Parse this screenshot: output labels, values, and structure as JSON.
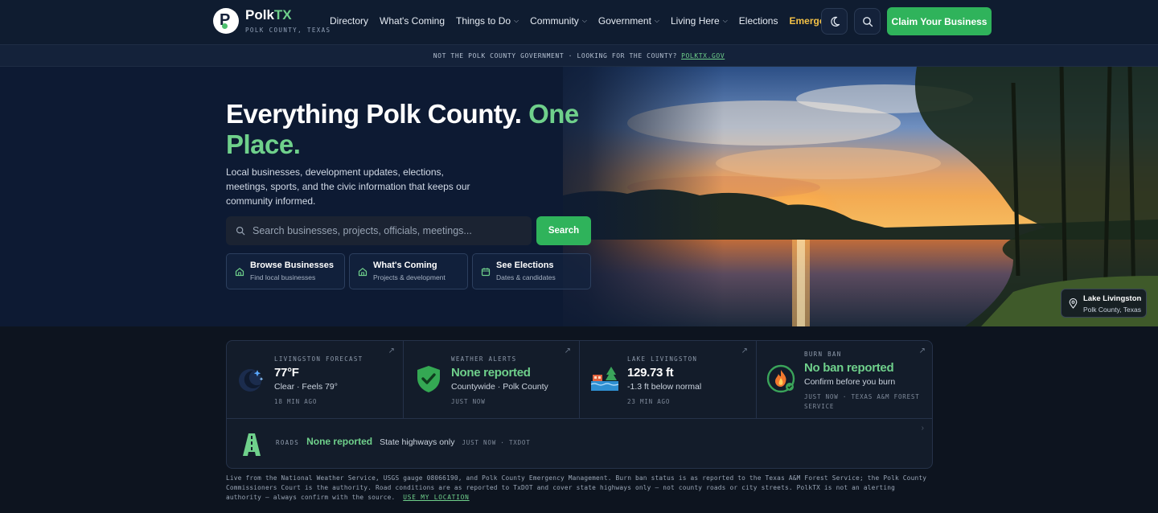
{
  "nav": {
    "brand": "Polk",
    "brand_accent": "TX",
    "brand_sub": "POLK COUNTY, TEXAS",
    "items": [
      {
        "label": "Directory",
        "dropdown": false
      },
      {
        "label": "What's Coming",
        "dropdown": false
      },
      {
        "label": "Things to Do",
        "dropdown": true
      },
      {
        "label": "Community",
        "dropdown": true
      },
      {
        "label": "Government",
        "dropdown": true
      },
      {
        "label": "Living Here",
        "dropdown": true
      },
      {
        "label": "Elections",
        "dropdown": false
      },
      {
        "label": "Emergency",
        "dropdown": false
      }
    ],
    "claim_label": "Claim Your Business"
  },
  "notice": {
    "text": "NOT THE POLK COUNTY GOVERNMENT · LOOKING FOR THE COUNTY?",
    "link": "POLKTX.GOV"
  },
  "hero": {
    "title_a": "Everything Polk County.",
    "title_b": "One Place.",
    "lead": "Local businesses, development updates, elections, meetings, sports, and the civic information that keeps our community informed.",
    "search_placeholder": "Search businesses, projects, officials, meetings...",
    "search_button": "Search",
    "quick": [
      {
        "title": "Browse Businesses",
        "sub": "Find local businesses",
        "icon": "home-icon"
      },
      {
        "title": "What's Coming",
        "sub": "Projects & development",
        "icon": "home-icon"
      },
      {
        "title": "See Elections",
        "sub": "Dates & candidates",
        "icon": "calendar-icon"
      }
    ],
    "location_title": "Lake Livingston",
    "location_sub": "Polk County, Texas"
  },
  "status": [
    {
      "label": "LIVINGSTON FORECAST",
      "value": "77°F",
      "sub": "Clear · Feels 79°",
      "ago": "18 MIN AGO",
      "icon": "night-sky-icon"
    },
    {
      "label": "WEATHER ALERTS",
      "value": "None reported",
      "sub": "Countywide · Polk County",
      "ago": "JUST NOW",
      "icon": "shield-check-icon"
    },
    {
      "label": "LAKE LIVINGSTON",
      "value": "129.73 ft",
      "sub": "-1.3 ft below normal",
      "ago": "23 MIN AGO",
      "icon": "lake-icon"
    },
    {
      "label": "BURN BAN",
      "value": "No ban reported",
      "sub": "Confirm before you burn",
      "ago": "JUST NOW · TEXAS A&M FOREST SERVICE",
      "icon": "fire-icon"
    }
  ],
  "roads": {
    "label": "ROADS",
    "value": "None reported",
    "sub": "State highways only",
    "ago": "JUST NOW · TXDOT"
  },
  "footnote": {
    "text": "Live from the National Weather Service, USGS gauge 08066190, and Polk County Emergency Management. Burn ban status is as reported to the Texas A&M Forest Service; the Polk County Commissioners Court is the authority. Road conditions are as reported to TxDOT and cover state highways only — not county roads or city streets. PolkTX is not an alerting authority — always confirm with the source.",
    "link": "USE MY LOCATION"
  },
  "colors": {
    "accent": "#2fb35b",
    "accent_text": "#6fd08b",
    "emergency": "#f3c146",
    "bg": "#0d141f"
  }
}
